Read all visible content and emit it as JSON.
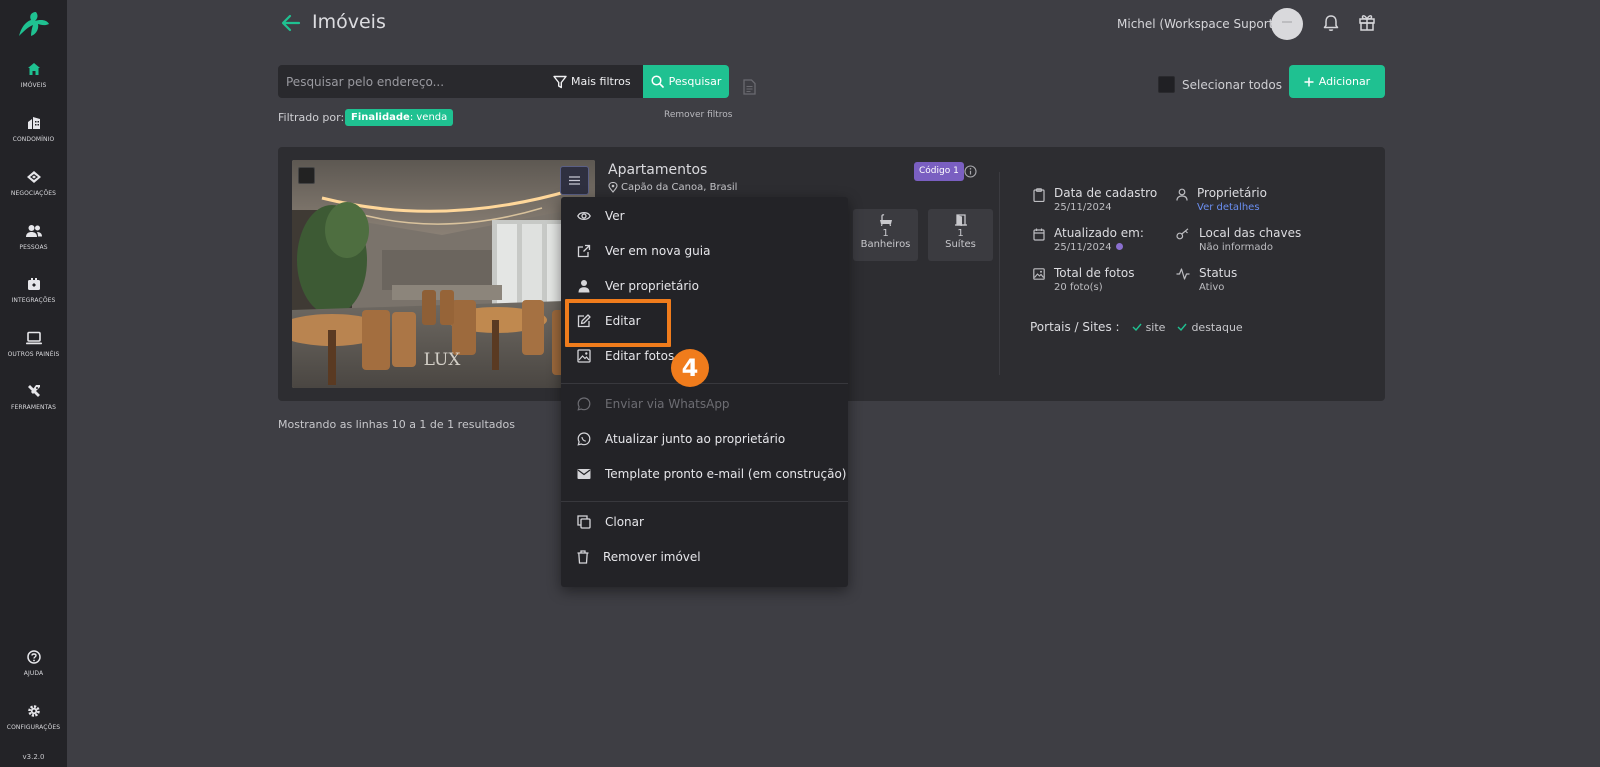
{
  "sidebar": {
    "items": [
      {
        "label": "IMÓVEIS",
        "icon": "home-icon"
      },
      {
        "label": "CONDOMÍNIO",
        "icon": "building-icon"
      },
      {
        "label": "NEGOCIAÇÕES",
        "icon": "handshake-icon"
      },
      {
        "label": "PESSOAS",
        "icon": "people-icon"
      },
      {
        "label": "INTEGRAÇÕES",
        "icon": "integrations-icon"
      },
      {
        "label": "OUTROS PAINÉIS",
        "icon": "monitor-icon"
      },
      {
        "label": "FERRAMENTAS",
        "icon": "tools-icon"
      }
    ],
    "help_label": "AJUDA",
    "settings_label": "CONFIGURAÇÕES",
    "version": "v3.2.0"
  },
  "header": {
    "title": "Imóveis",
    "user_name": "Michel (Workspace Suporte)"
  },
  "search": {
    "placeholder": "Pesquisar pelo endereço...",
    "more_filters_label": "Mais filtros",
    "search_button_label": "Pesquisar"
  },
  "filters": {
    "filtered_by_label": "Filtrado por:",
    "chip_key": "Finalidade",
    "chip_value": ": venda",
    "remove_label": "Remover filtros"
  },
  "actions": {
    "select_all_label": "Selecionar todos",
    "add_label": "Adicionar"
  },
  "property": {
    "type": "Apartamentos",
    "location": "Capão da Canoa, Brasil",
    "code": "Código 1",
    "photo_watermark": "LUX",
    "features": [
      {
        "count": "1",
        "label": "Banheiros"
      },
      {
        "count": "1",
        "label": "Suítes"
      }
    ],
    "meta": {
      "created_title": "Data de cadastro",
      "created_value": "25/11/2024",
      "updated_title": "Atualizado em:",
      "updated_value": "25/11/2024",
      "photos_title": "Total de fotos",
      "photos_value": "20 foto(s)",
      "owner_title": "Proprietário",
      "owner_value": "Ver detalhes",
      "keys_title": "Local das chaves",
      "keys_value": "Não informado",
      "status_title": "Status",
      "status_value": "Ativo"
    },
    "portals_label": "Portais / Sites :",
    "portals": [
      "site",
      "destaque"
    ]
  },
  "results_text": "Mostrando as linhas 10 a 1 de 1 resultados",
  "menu": {
    "items": [
      "Ver",
      "Ver em nova guia",
      "Ver proprietário",
      "Editar",
      "Editar fotos",
      "Enviar via WhatsApp",
      "Atualizar junto ao proprietário",
      "Template pronto e-mail (em construção)",
      "Clonar",
      "Remover imóvel"
    ]
  },
  "step_number": "4",
  "colors": {
    "accent": "#1fc191",
    "highlight": "#f07c1c",
    "code_badge": "#7a5fc1",
    "link": "#6a8ef0"
  }
}
